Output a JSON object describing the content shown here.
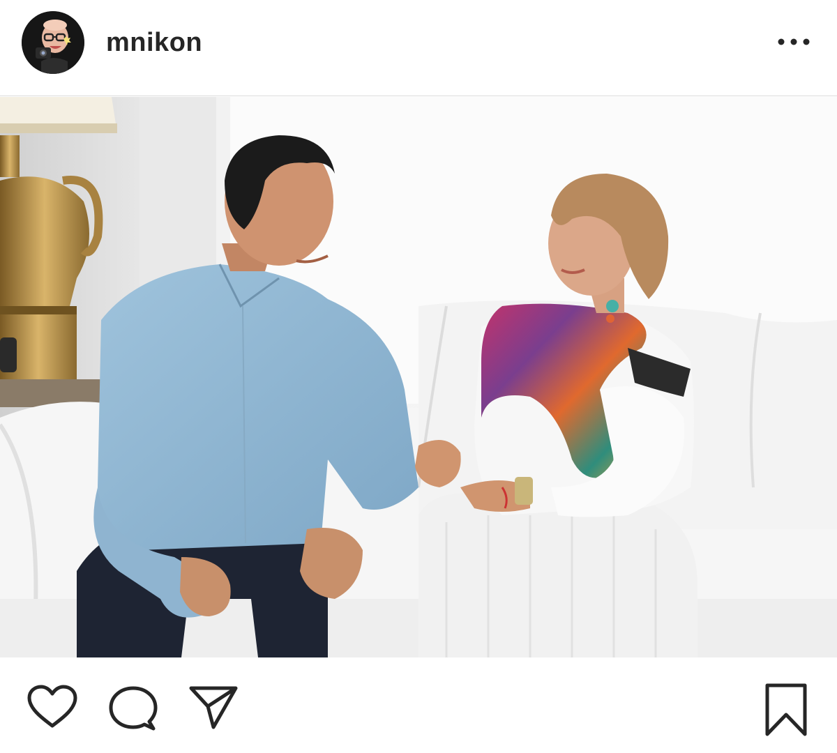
{
  "post": {
    "username": "mnikon",
    "more_options_label": "•••",
    "avatar_icon": "memoji-camera-avatar",
    "photo_description_icon": "photo-two-people-on-white-sofa"
  },
  "actions": {
    "like_icon": "heart-icon",
    "comment_icon": "comment-bubble-icon",
    "share_icon": "paper-plane-icon",
    "save_icon": "bookmark-icon"
  },
  "colors": {
    "text": "#262626",
    "divider": "#dbdbdb",
    "background": "#ffffff"
  }
}
